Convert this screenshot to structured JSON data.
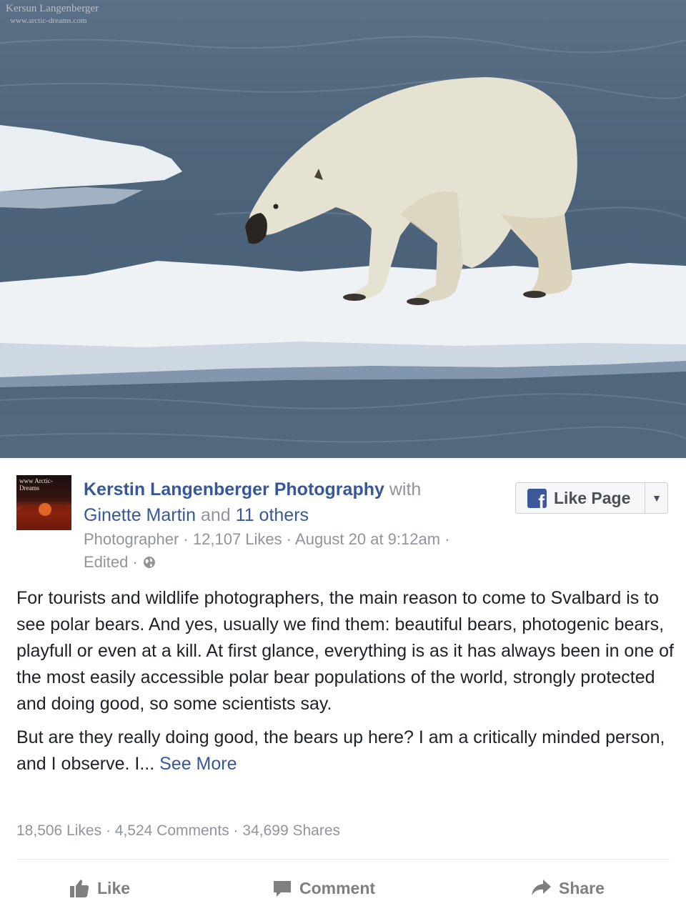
{
  "photo": {
    "watermark_line1": "Kersun Langenberger",
    "watermark_line2": "www.arctic-dreams.com",
    "subject": "polar bear on ice floe"
  },
  "post": {
    "avatar_text": "www Arctic-Dreams",
    "page_name": "Kerstin Langenberger Photography",
    "with_word": "with",
    "tagged_name": "Ginette Martin",
    "and_word": "and",
    "others": "11 others",
    "category": "Photographer",
    "likes_count": "12,107 Likes",
    "date": "August 20 at 9:12am",
    "edited": "Edited",
    "separator": "·",
    "globe_icon": "globe-icon",
    "like_page_label": "Like Page",
    "paragraph1": "For tourists and wildlife photographers, the main reason to come to Svalbard is to see polar bears. And yes, usually we find them: beautiful bears, photogenic bears, playfull or even at a kill. At first glance, everything is as it has always been in one of the most easily accessible polar bear populations of the world, strongly protected and doing good, so some scientists say.",
    "paragraph2": "But are they really doing good, the bears up here? I am a critically minded person, and I observe. I...",
    "see_more": "See More",
    "stats_likes": "18,506 Likes",
    "stats_comments": "4,524 Comments",
    "stats_shares": "34,699 Shares"
  },
  "actions": {
    "like": "Like",
    "comment": "Comment",
    "share": "Share"
  },
  "colors": {
    "link": "#365899",
    "muted": "#90949c",
    "facebook_blue": "#3b5998"
  }
}
